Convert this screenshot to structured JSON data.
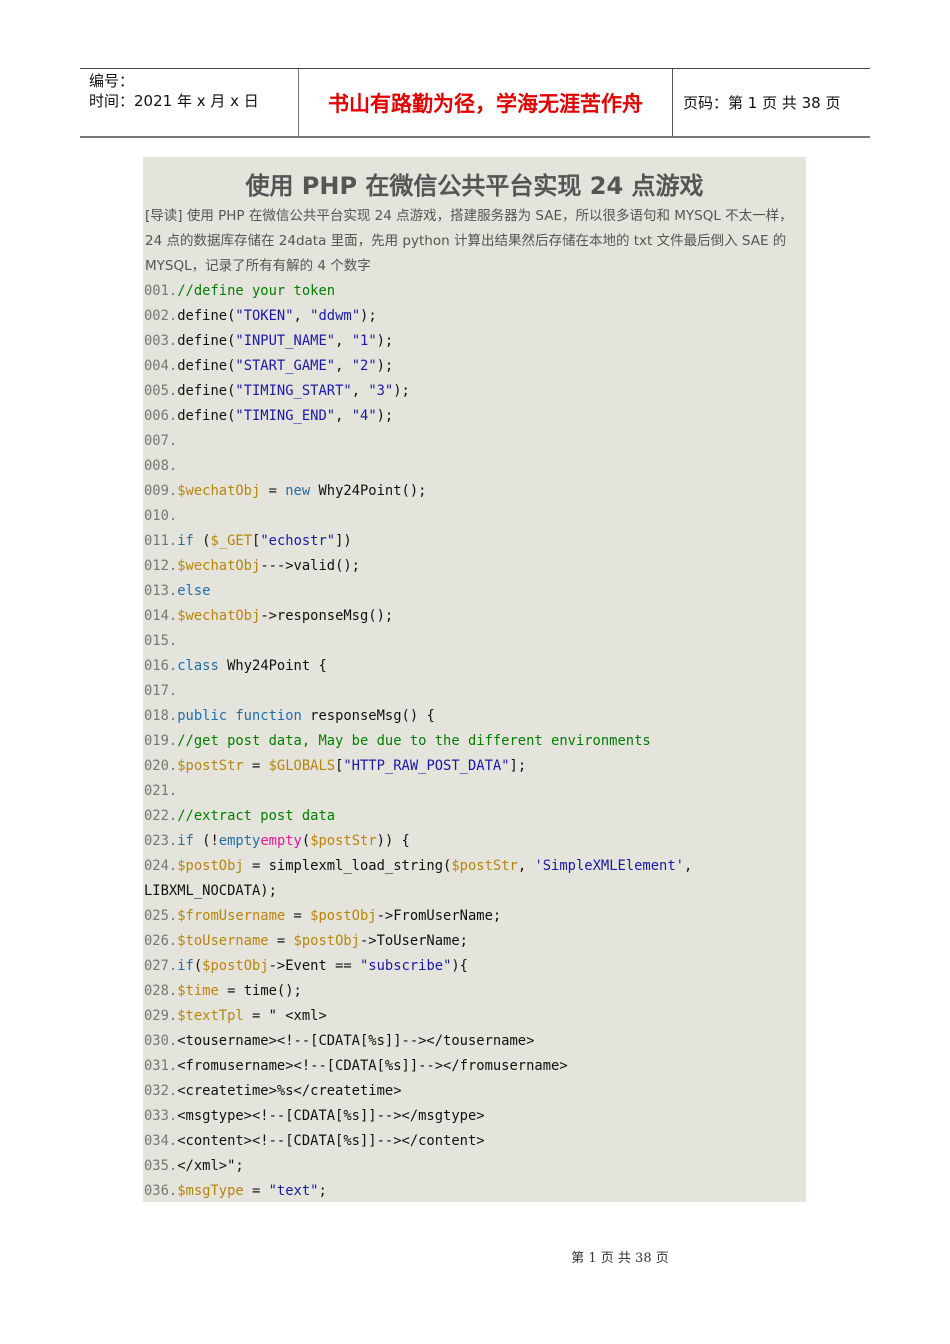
{
  "header": {
    "number_label": "编号：",
    "time_label": "时间：2021 年 x 月 x 日",
    "motto": "书山有路勤为径，学海无涯苦作舟",
    "page_label": "页码：第 1 页  共 38 页"
  },
  "title": "使用 PHP 在微信公共平台实现 24 点游戏",
  "intro": "[导读] 使用 PHP 在微信公共平台实现 24 点游戏，搭建服务器为 SAE，所以很多语句和 MYSQL 不太一样，24 点的数据库存储在 24data 里面，先用 python 计算出结果然后存储在本地的 txt 文件最后倒入 SAE 的 MYSQL，记录了所有有解的 4 个数字",
  "code": [
    [
      [
        "ln",
        "001."
      ],
      [
        "cm",
        "//define your token"
      ]
    ],
    [
      [
        "ln",
        "002."
      ],
      [
        "pl",
        "define("
      ],
      [
        "st",
        "\"TOKEN\""
      ],
      [
        "pl",
        ", "
      ],
      [
        "st",
        "\"ddwm\""
      ],
      [
        "pl",
        ");"
      ]
    ],
    [
      [
        "ln",
        "003."
      ],
      [
        "pl",
        "define("
      ],
      [
        "st",
        "\"INPUT_NAME\""
      ],
      [
        "pl",
        ", "
      ],
      [
        "st",
        "\"1\""
      ],
      [
        "pl",
        ");"
      ]
    ],
    [
      [
        "ln",
        "004."
      ],
      [
        "pl",
        "define("
      ],
      [
        "st",
        "\"START_GAME\""
      ],
      [
        "pl",
        ", "
      ],
      [
        "st",
        "\"2\""
      ],
      [
        "pl",
        ");"
      ]
    ],
    [
      [
        "ln",
        "005."
      ],
      [
        "pl",
        "define("
      ],
      [
        "st",
        "\"TIMING_START\""
      ],
      [
        "pl",
        ", "
      ],
      [
        "st",
        "\"3\""
      ],
      [
        "pl",
        ");"
      ]
    ],
    [
      [
        "ln",
        "006."
      ],
      [
        "pl",
        "define("
      ],
      [
        "st",
        "\"TIMING_END\""
      ],
      [
        "pl",
        ", "
      ],
      [
        "st",
        "\"4\""
      ],
      [
        "pl",
        ");"
      ]
    ],
    [
      [
        "ln",
        "007."
      ]
    ],
    [
      [
        "ln",
        "008."
      ]
    ],
    [
      [
        "ln",
        "009."
      ],
      [
        "vr",
        "$wechatObj"
      ],
      [
        "pl",
        " = "
      ],
      [
        "kw",
        "new"
      ],
      [
        "pl",
        " Why24Point();"
      ]
    ],
    [
      [
        "ln",
        "010."
      ]
    ],
    [
      [
        "ln",
        "011."
      ],
      [
        "kw",
        "if"
      ],
      [
        "pl",
        " ("
      ],
      [
        "vr",
        "$_GET"
      ],
      [
        "pl",
        "["
      ],
      [
        "st",
        "\"echostr\""
      ],
      [
        "pl",
        "])"
      ]
    ],
    [
      [
        "ln",
        "012."
      ],
      [
        "vr",
        "$wechatObj"
      ],
      [
        "pl",
        "--->valid();"
      ]
    ],
    [
      [
        "ln",
        "013."
      ],
      [
        "kw",
        "else"
      ]
    ],
    [
      [
        "ln",
        "014."
      ],
      [
        "vr",
        "$wechatObj"
      ],
      [
        "pl",
        "->responseMsg();"
      ]
    ],
    [
      [
        "ln",
        "015."
      ]
    ],
    [
      [
        "ln",
        "016."
      ],
      [
        "kw",
        "class"
      ],
      [
        "pl",
        " Why24Point {"
      ]
    ],
    [
      [
        "ln",
        "017."
      ]
    ],
    [
      [
        "ln",
        "018."
      ],
      [
        "kw",
        "public function"
      ],
      [
        "pl",
        " responseMsg() {"
      ]
    ],
    [
      [
        "ln",
        "019."
      ],
      [
        "cm",
        "//get post data, May be due to the different environments"
      ]
    ],
    [
      [
        "ln",
        "020."
      ],
      [
        "vr",
        "$postStr"
      ],
      [
        "pl",
        " = "
      ],
      [
        "vr",
        "$GLOBALS"
      ],
      [
        "pl",
        "["
      ],
      [
        "st",
        "\"HTTP_RAW_POST_DATA\""
      ],
      [
        "pl",
        "];"
      ]
    ],
    [
      [
        "ln",
        "021."
      ]
    ],
    [
      [
        "ln",
        "022."
      ],
      [
        "cm",
        "//extract post data"
      ]
    ],
    [
      [
        "ln",
        "023."
      ],
      [
        "kw",
        "if"
      ],
      [
        "pl",
        " (!"
      ],
      [
        "kw",
        "empty"
      ],
      [
        "em",
        "empty"
      ],
      [
        "pl",
        "("
      ],
      [
        "vr",
        "$postStr"
      ],
      [
        "pl",
        ")) {"
      ]
    ],
    [
      [
        "ln",
        "024."
      ],
      [
        "vr",
        "$postObj"
      ],
      [
        "pl",
        " = simplexml_load_string("
      ],
      [
        "vr",
        "$postStr"
      ],
      [
        "pl",
        ", "
      ],
      [
        "st",
        "'SimpleXMLElement'"
      ],
      [
        "pl",
        ","
      ]
    ],
    [
      [
        "pl",
        "LIBXML_NOCDATA);"
      ]
    ],
    [
      [
        "ln",
        "025."
      ],
      [
        "vr",
        "$fromUsername"
      ],
      [
        "pl",
        " = "
      ],
      [
        "vr",
        "$postObj"
      ],
      [
        "pl",
        "->FromUserName;"
      ]
    ],
    [
      [
        "ln",
        "026."
      ],
      [
        "vr",
        "$toUsername"
      ],
      [
        "pl",
        " = "
      ],
      [
        "vr",
        "$postObj"
      ],
      [
        "pl",
        "->ToUserName;"
      ]
    ],
    [
      [
        "ln",
        "027."
      ],
      [
        "kw",
        "if"
      ],
      [
        "pl",
        "("
      ],
      [
        "vr",
        "$postObj"
      ],
      [
        "pl",
        "->Event == "
      ],
      [
        "st",
        "\"subscribe\""
      ],
      [
        "pl",
        "){"
      ]
    ],
    [
      [
        "ln",
        "028."
      ],
      [
        "vr",
        "$time"
      ],
      [
        "pl",
        " = time();"
      ]
    ],
    [
      [
        "ln",
        "029."
      ],
      [
        "vr",
        "$textTpl"
      ],
      [
        "pl",
        " = \" <xml>"
      ]
    ],
    [
      [
        "ln",
        "030."
      ],
      [
        "pl",
        "<tousername><!--[CDATA[%s]]--></tousername>"
      ]
    ],
    [
      [
        "ln",
        "031."
      ],
      [
        "pl",
        "<fromusername><!--[CDATA[%s]]--></fromusername>"
      ]
    ],
    [
      [
        "ln",
        "032."
      ],
      [
        "pl",
        "<createtime>%s</createtime>"
      ]
    ],
    [
      [
        "ln",
        "033."
      ],
      [
        "pl",
        "<msgtype><!--[CDATA[%s]]--></msgtype>"
      ]
    ],
    [
      [
        "ln",
        "034."
      ],
      [
        "pl",
        "<content><!--[CDATA[%s]]--></content>"
      ]
    ],
    [
      [
        "ln",
        "035."
      ],
      [
        "pl",
        "</xml>\";"
      ]
    ],
    [
      [
        "ln",
        "036."
      ],
      [
        "vr",
        "$msgType"
      ],
      [
        "pl",
        " = "
      ],
      [
        "st",
        "\"text\""
      ],
      [
        "pl",
        ";"
      ]
    ]
  ],
  "footer": "第  1  页  共  38  页"
}
